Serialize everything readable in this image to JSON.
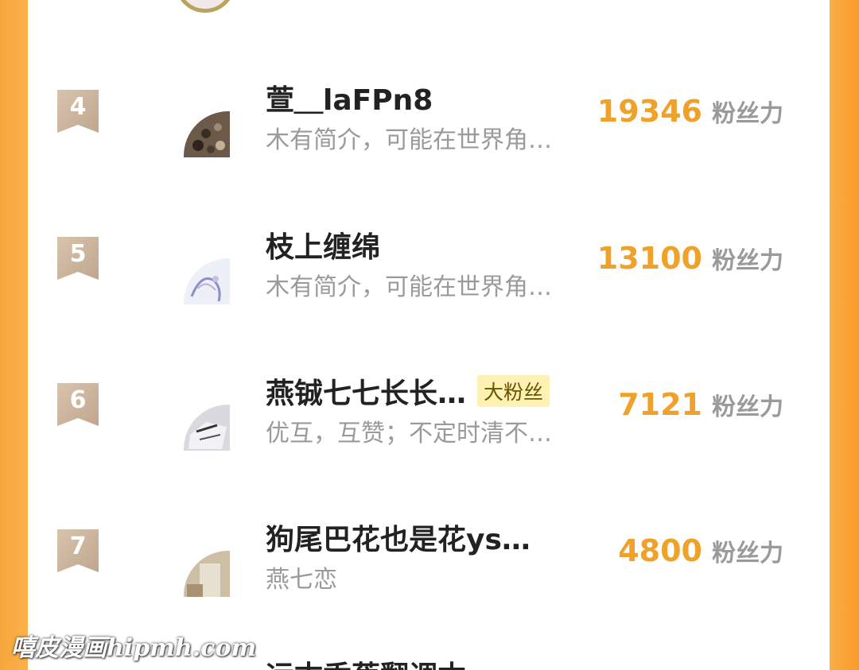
{
  "ranking": {
    "score_unit": "粉丝力",
    "items": [
      {
        "rank": "4",
        "name": "萱＿laFPn8",
        "intro": "木有简介，可能在世界角…",
        "score": "19346",
        "tag": ""
      },
      {
        "rank": "5",
        "name": "枝上缠绵",
        "intro": "木有简介，可能在世界角…",
        "score": "13100",
        "tag": ""
      },
      {
        "rank": "6",
        "name": "燕铖七七长长…",
        "intro": "优互，互赞；不定时清不…",
        "score": "7121",
        "tag": "大粉丝"
      },
      {
        "rank": "7",
        "name": "狗尾巴花也是花ys…",
        "intro": "燕七恋",
        "score": "4800",
        "tag": ""
      }
    ],
    "next_item_partial_name": "远古香蕉翻调本"
  },
  "watermark": "嘻皮漫画hipmh.com",
  "colors": {
    "background_orange": "#fbb24a",
    "score_orange": "#f0a12a",
    "badge_tan": "#c9b29a",
    "tag_yellow": "#fdf2b3"
  },
  "icons": {
    "rank_badge": "ribbon-bookmark-icon"
  }
}
